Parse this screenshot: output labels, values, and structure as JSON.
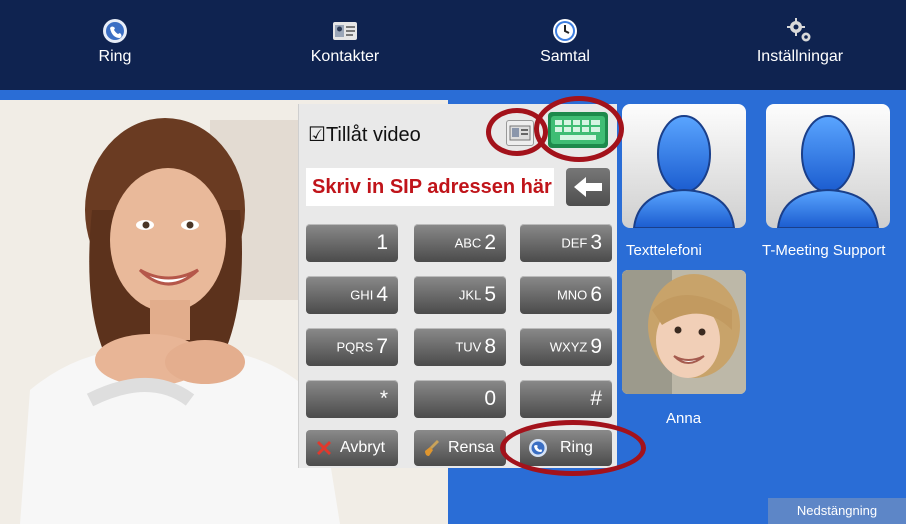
{
  "nav": {
    "tabs": [
      {
        "label": "Ring",
        "icon": "phone-globe-icon"
      },
      {
        "label": "Kontakter",
        "icon": "contact-card-icon"
      },
      {
        "label": "Samtal",
        "icon": "clock-icon"
      },
      {
        "label": "Inställningar",
        "icon": "gears-icon"
      }
    ]
  },
  "dialer": {
    "video_checkbox_label": "Tillåt video",
    "video_checked": true,
    "sip_input_text": "Skriv in SIP adressen här",
    "keys": [
      {
        "sub": "",
        "digit": "1"
      },
      {
        "sub": "ABC",
        "digit": "2"
      },
      {
        "sub": "DEF",
        "digit": "3"
      },
      {
        "sub": "GHI",
        "digit": "4"
      },
      {
        "sub": "JKL",
        "digit": "5"
      },
      {
        "sub": "MNO",
        "digit": "6"
      },
      {
        "sub": "PQRS",
        "digit": "7"
      },
      {
        "sub": "TUV",
        "digit": "8"
      },
      {
        "sub": "WXYZ",
        "digit": "9"
      },
      {
        "sub": "",
        "digit": "*"
      },
      {
        "sub": "",
        "digit": "0"
      },
      {
        "sub": "",
        "digit": "#"
      }
    ],
    "actions": {
      "cancel": "Avbryt",
      "clear": "Rensa",
      "call": "Ring"
    }
  },
  "contacts": [
    {
      "name": "Texttelefoni",
      "icon": "person-silhouette-icon"
    },
    {
      "name": "T-Meeting Support",
      "icon": "person-silhouette-icon"
    },
    {
      "name": "Anna",
      "icon": "contact-photo"
    }
  ],
  "shutdown_label": "Nedstängning",
  "colors": {
    "nav_bg": "#0f2350",
    "main_bg": "#2a6dd6",
    "highlight_ring": "#a3121b",
    "sip_text": "#c0141a",
    "keypad_icon": "#35b06a"
  }
}
